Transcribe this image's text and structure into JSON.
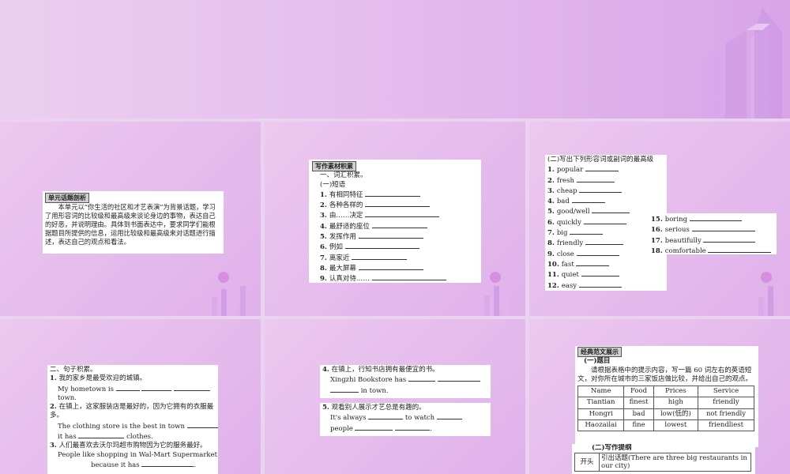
{
  "colors": {
    "slide_bg": "#e6bdee",
    "bar_light": "#e9c8f1",
    "bar_mid": "#dcaaea",
    "bar_dark": "#c98fdf"
  },
  "slide2": {
    "heading": "单元话题剖析",
    "paragraph": "本单元以“你生活的社区和才艺表演”为背景话题，学习了用形容词的比较级和最高级来谈论身边的事物，表达自己的好恶，并说明理由。具体到书面表达中，要求同学们能根据题目所提供的信息，运用比较级和最高级来对话题进行描述，表达自己的观点和看法。"
  },
  "slide3": {
    "heading": "写作素材积累",
    "sub1": "一、词汇积累。",
    "sub2": "(一)短语",
    "items": [
      {
        "n": "1.",
        "text": "有相同特征"
      },
      {
        "n": "2.",
        "text": "各种各样的"
      },
      {
        "n": "3.",
        "text": "由……决定"
      },
      {
        "n": "4.",
        "text": "最舒适的座位"
      },
      {
        "n": "5.",
        "text": "发挥作用"
      },
      {
        "n": "6.",
        "text": "例如"
      },
      {
        "n": "7.",
        "text": "离家近"
      },
      {
        "n": "8.",
        "text": "最大屏幕"
      },
      {
        "n": "9.",
        "text": "认真对待……"
      },
      {
        "n": "10.",
        "text": "最新鲜的食物"
      }
    ]
  },
  "slide4": {
    "heading": "(二)写出下列形容词或副词的最高级",
    "left_items": [
      {
        "n": "1.",
        "text": "popular"
      },
      {
        "n": "2.",
        "text": "fresh"
      },
      {
        "n": "3.",
        "text": "cheap"
      },
      {
        "n": "4.",
        "text": "bad"
      },
      {
        "n": "5.",
        "text": "good/well"
      },
      {
        "n": "6.",
        "text": "quickly"
      },
      {
        "n": "7.",
        "text": "big"
      },
      {
        "n": "8.",
        "text": "friendly"
      },
      {
        "n": "9.",
        "text": "close"
      },
      {
        "n": "10.",
        "text": "fast"
      },
      {
        "n": "11.",
        "text": "quiet"
      },
      {
        "n": "12.",
        "text": "easy"
      },
      {
        "n": "13.",
        "text": "much"
      },
      {
        "n": "14.",
        "text": "creative"
      }
    ],
    "right_items": [
      {
        "n": "15.",
        "text": "boring"
      },
      {
        "n": "16.",
        "text": "serious"
      },
      {
        "n": "17.",
        "text": "beautifully"
      },
      {
        "n": "18.",
        "text": "comfortable"
      }
    ]
  },
  "slide5": {
    "heading": "二、句子积累。",
    "s1_cn": "我的家乡是最受欢迎的城镇。",
    "s1_en_a": "My hometown is",
    "s1_en_b": "town.",
    "s2_cn": "在镇上，这家服装店是最好的，因为它拥有的衣服最多。",
    "s2_en_a": "The clothing store is the best in town",
    "s2_en_b": "it has",
    "s2_en_c": "clothes.",
    "s3_cn": "人们最喜欢去沃尔玛超市购物因为它的服务最好。",
    "s3_en_a": "People like shopping in Wal-Mart Supermarket",
    "s3_en_b": "because it has"
  },
  "slide6": {
    "s4_cn": "在镇上，行知书店拥有最便宜的书。",
    "s4_en_a": "Xingzhi Bookstore has",
    "s4_en_b": "in town.",
    "s5_cn": "观看别人展示才艺总是有趣的。",
    "s5_en_a": "It's always",
    "s5_en_b": "to watch",
    "s5_en_c": "people"
  },
  "slide7": {
    "heading": "经典范文展示",
    "sub1": "(一)题目",
    "prompt": "请根据表格中的提示内容，写一篇 60 词左右的英语短文，对你所在城市的三家饭店做比较，并给出自己的观点。",
    "table_headers": [
      "Name",
      "Food",
      "Prices",
      "Service"
    ],
    "table_rows": [
      [
        "Tiantian",
        "finest",
        "high",
        "friendly"
      ],
      [
        "Hongri",
        "bad",
        "low(低的)",
        "not friendly"
      ],
      [
        "Haozailai",
        "fine",
        "lowest",
        "friendliest"
      ]
    ],
    "sub2": "(二)写作提纲",
    "outline_label": "开头",
    "outline_text": "引出话题(There are three big restaurants in our city)"
  }
}
